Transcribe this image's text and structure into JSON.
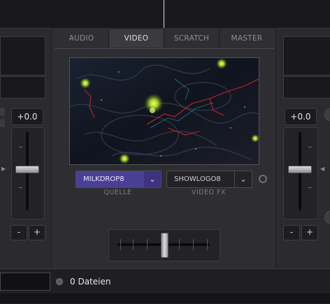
{
  "tabs": [
    {
      "label": "AUDIO",
      "active": false
    },
    {
      "label": "VIDEO",
      "active": true
    },
    {
      "label": "SCRATCH",
      "active": false
    },
    {
      "label": "MASTER",
      "active": false
    }
  ],
  "left_deck": {
    "gain_value": "+0.0",
    "minus_label": "-",
    "plus_label": "+"
  },
  "right_deck": {
    "gain_value": "+0.0",
    "minus_label": "-",
    "plus_label": "+"
  },
  "video_source": {
    "selected": "MILKDROP8",
    "caption": "QUELLE"
  },
  "video_fx": {
    "selected": "SHOWLOGO8",
    "caption": "VIDEO FX"
  },
  "browser": {
    "file_count": "0 Dateien"
  },
  "colors": {
    "accent": "#4b3f94",
    "panel": "#2e2e32",
    "background": "#202023"
  },
  "icons": [
    "chevron-down-icon",
    "gear-icon",
    "disc-icon",
    "arrow-right-icon",
    "arrow-left-icon"
  ]
}
